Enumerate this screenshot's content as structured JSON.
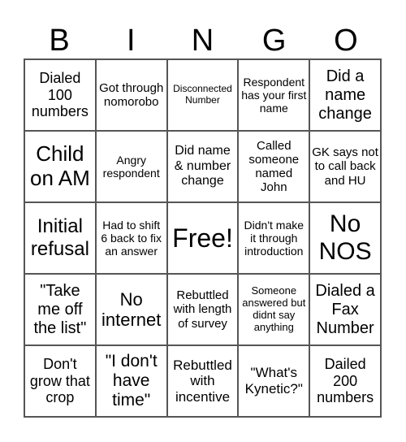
{
  "header": {
    "letters": [
      "B",
      "I",
      "N",
      "G",
      "O"
    ]
  },
  "cells": [
    "Dialed 100 numbers",
    "Got through nomorobo",
    "Disconnected Number",
    "Respondent has your first name",
    "Did a name change",
    "Child on AM",
    "Angry respondent",
    "Did name & number change",
    "Called someone named John",
    "GK says not to call back and HU",
    "Initial refusal",
    "Had to shift 6 back to fix an answer",
    "Free!",
    "Didn't make it through introduction",
    "No NOS",
    "\"Take me off the list\"",
    "No internet",
    "Rebuttled with length of survey",
    "Someone answered but didnt say anything",
    "Dialed a Fax Number",
    "Don't grow that crop",
    "\"I don't have time\"",
    "Rebuttled with incentive",
    "\"What's Kynetic?\"",
    "Dailed 200 numbers"
  ]
}
